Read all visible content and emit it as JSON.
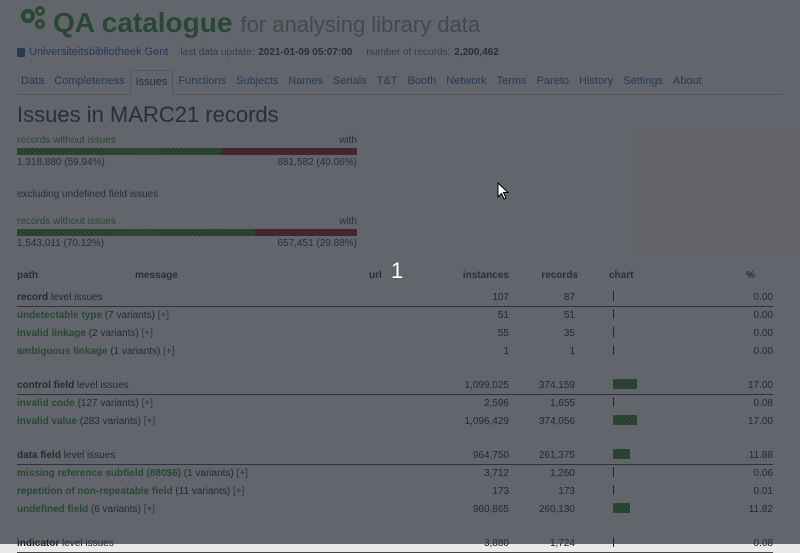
{
  "app": {
    "title": "QA catalogue",
    "subtitle": "for analysing library data"
  },
  "meta": {
    "library": "Universiteitsbibliotheek Gent",
    "last_update_label": "last data update:",
    "last_update_value": "2021-01-09 05:07:00",
    "records_label": "number of records:",
    "records_value": "2,200,462"
  },
  "tabs": [
    "Data",
    "Completeness",
    "Issues",
    "Functions",
    "Subjects",
    "Names",
    "Serials",
    "T&T",
    "Booth",
    "Network",
    "Terms",
    "Pareto",
    "History",
    "Settings",
    "About"
  ],
  "active_tab": "Issues",
  "page_title": "Issues in MARC21 records",
  "bars": [
    {
      "left_label": "records without issues",
      "right_label": "with",
      "left_value": "1,318,880 (59.94%)",
      "right_value": "881,582 (40.06%)",
      "fraction": 0.5994
    },
    {
      "left_label": "records without issues",
      "right_label": "with",
      "left_value": "1,543,011 (70.12%)",
      "right_value": "657,451 (29.88%)",
      "fraction": 0.7012
    }
  ],
  "excluding_text": "excluding undefined field issues",
  "marker": "1",
  "table": {
    "headers": {
      "path": "path",
      "message": "message",
      "url": "url",
      "instances": "instances",
      "records": "records",
      "chart": "chart",
      "pct": "%"
    },
    "rows": [
      {
        "kind": "section",
        "name_bold": "record",
        "name_rest": " level issues",
        "instances": "107",
        "records": "87",
        "pct": "0.00",
        "chart": 0
      },
      {
        "kind": "item",
        "name": "undetectable type",
        "variants": " (7 variants) ",
        "plus": "[+]",
        "instances": "51",
        "records": "51",
        "pct": "0.00",
        "chart": 0
      },
      {
        "kind": "item",
        "name": "invalid linkage",
        "variants": " (2 variants) ",
        "plus": "[+]",
        "instances": "55",
        "records": "35",
        "pct": "0.00",
        "chart": 0
      },
      {
        "kind": "item",
        "name": "ambiguous linkage",
        "variants": " (1 variants) ",
        "plus": "[+]",
        "instances": "1",
        "records": "1",
        "pct": "0.00",
        "chart": 0
      },
      {
        "kind": "section",
        "name_bold": "control field",
        "name_rest": " level issues",
        "instances": "1,099,025",
        "records": "374,159",
        "pct": "17.00",
        "chart": 17.0
      },
      {
        "kind": "item",
        "name": "invalid code",
        "variants": " (127 variants) ",
        "plus": "[+]",
        "instances": "2,596",
        "records": "1,655",
        "pct": "0.08",
        "chart": 0.08
      },
      {
        "kind": "item",
        "name": "invalid value",
        "variants": " (283 variants) ",
        "plus": "[+]",
        "instances": "1,096,429",
        "records": "374,056",
        "pct": "17.00",
        "chart": 17.0
      },
      {
        "kind": "section",
        "name_bold": "data field",
        "name_rest": " level issues",
        "instances": "964,750",
        "records": "261,375",
        "pct": "11.88",
        "chart": 11.88
      },
      {
        "kind": "item",
        "name": "missing reference subfield (880$6)",
        "variants": " (1 variants) ",
        "plus": "[+]",
        "instances": "3,712",
        "records": "1,260",
        "pct": "0.06",
        "chart": 0.06
      },
      {
        "kind": "item",
        "name": "repetition of non-repeatable field",
        "variants": " (11 variants) ",
        "plus": "[+]",
        "instances": "173",
        "records": "173",
        "pct": "0.01",
        "chart": 0.01
      },
      {
        "kind": "item",
        "name": "undefined field",
        "variants": " (6 variants) ",
        "plus": "[+]",
        "instances": "960,865",
        "records": "260,130",
        "pct": "11.82",
        "chart": 11.82
      },
      {
        "kind": "section",
        "name_bold": "indicator",
        "name_rest": " level issues",
        "instances": "3,880",
        "records": "1,724",
        "pct": "0.08",
        "chart": 0.08
      }
    ]
  }
}
